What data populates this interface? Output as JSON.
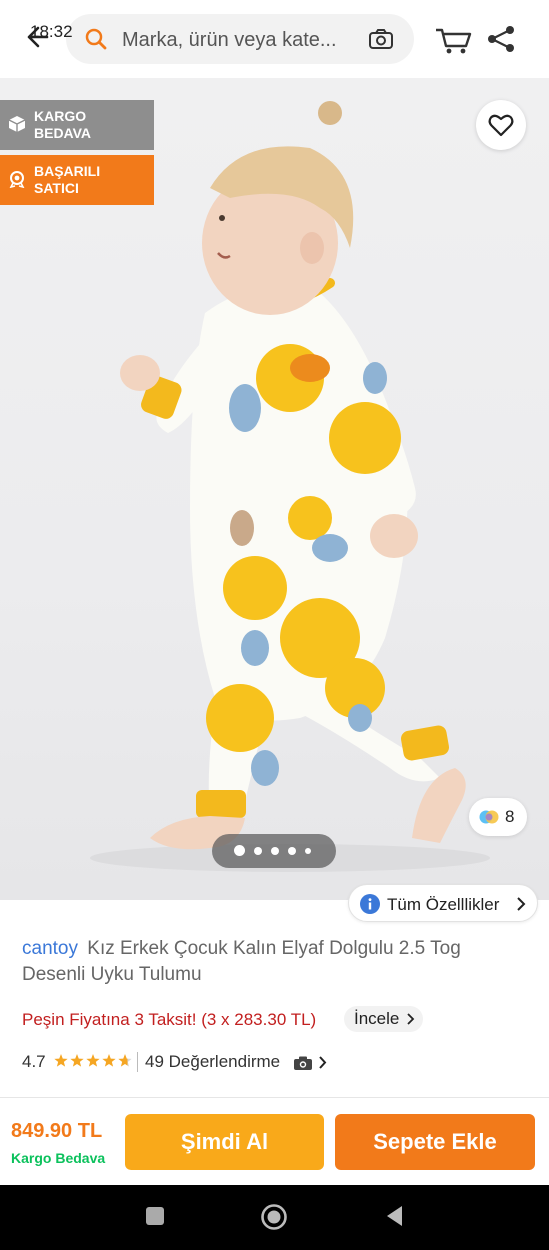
{
  "status_bar": {
    "time": "18:32"
  },
  "search": {
    "placeholder": "Marka, ürün veya kate..."
  },
  "badges": {
    "cargo": [
      "KARGO",
      "BEDAVA"
    ],
    "seller": [
      "BAŞARILI",
      "SATICI"
    ]
  },
  "gallery": {
    "variant_count": "8",
    "image_count": 5,
    "active_index": 0
  },
  "features_button": {
    "label": "Tüm Özelllikler"
  },
  "product": {
    "brand": "cantoy",
    "title": "Kız Erkek Çocuk Kalın Elyaf Dolgulu 2.5 Tog Desenli Uyku Tulumu",
    "installment_text": "Peşin Fiyatına 3 Taksit! (3 x 283.30 TL)",
    "installment_link": "İncele",
    "rating": "4.7",
    "rating_stars": 4.7,
    "reviews_label": "49 Değerlendirme"
  },
  "bottom_bar": {
    "price": "849.90 TL",
    "cargo_text": "Kargo Bedava",
    "buy_now": "Şimdi Al",
    "add_to_cart": "Sepete Ekle"
  },
  "colors": {
    "brand_orange": "#f27a1a",
    "buy_now_yellow": "#f9a91a",
    "link_blue": "#3b78d8",
    "installment_red": "#c21f1f",
    "cargo_green": "#0bc15c"
  },
  "icons": [
    "back-arrow-icon",
    "search-icon",
    "camera-icon",
    "cart-icon",
    "share-icon",
    "box-icon",
    "medal-icon",
    "heart-icon",
    "color-palette-icon",
    "info-icon",
    "chevron-right-icon",
    "star-icon"
  ]
}
